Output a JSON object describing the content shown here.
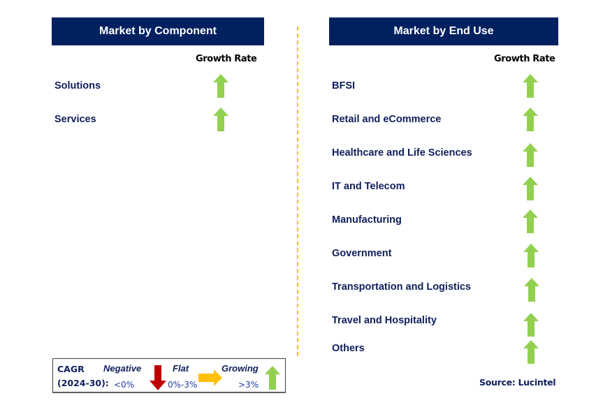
{
  "left_panel": {
    "title": "Market by Component",
    "growth_rate_label": "Growth Rate",
    "items": [
      {
        "label": "Solutions",
        "trend": "growing"
      },
      {
        "label": "Services",
        "trend": "growing"
      }
    ]
  },
  "right_panel": {
    "title": "Market by End Use",
    "growth_rate_label": "Growth Rate",
    "items": [
      {
        "label": "BFSI",
        "trend": "growing"
      },
      {
        "label": "Retail and eCommerce",
        "trend": "growing"
      },
      {
        "label": "Healthcare and Life Sciences",
        "trend": "growing"
      },
      {
        "label": "IT and Telecom",
        "trend": "growing"
      },
      {
        "label": "Manufacturing",
        "trend": "growing"
      },
      {
        "label": "Government",
        "trend": "growing"
      },
      {
        "label": "Transportation and Logistics",
        "trend": "growing"
      },
      {
        "label": "Travel and Hospitality",
        "trend": "growing"
      },
      {
        "label": "Others",
        "trend": "growing"
      }
    ]
  },
  "legend": {
    "cagr_line1": "CAGR",
    "cagr_line2": "(2024-30):",
    "negative": {
      "label": "Negative",
      "range": "<0%",
      "icon": "down-arrow-icon",
      "color": "#c00000"
    },
    "flat": {
      "label": "Flat",
      "range": "0%-3%",
      "icon": "right-arrow-icon",
      "color": "#ffc000"
    },
    "growing": {
      "label": "Growing",
      "range": ">3%",
      "icon": "up-arrow-icon",
      "color": "#92d050"
    }
  },
  "source": "Source: Lucintel",
  "colors": {
    "header_bg": "#002060",
    "text_navy": "#0f1f5c",
    "divider": "#ffc000",
    "growing": "#92d050"
  }
}
